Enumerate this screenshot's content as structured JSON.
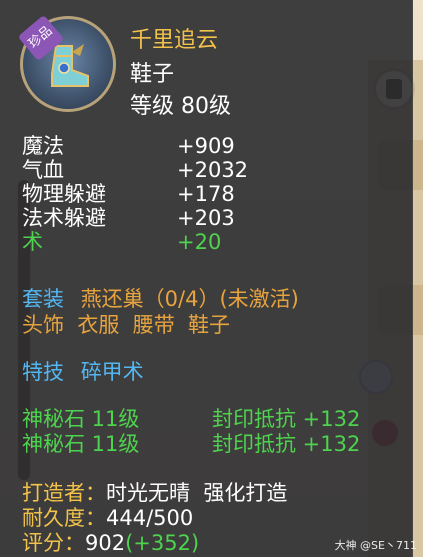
{
  "item": {
    "rarity_tag": "珍品",
    "name": "千里追云",
    "type": "鞋子",
    "level": "等级 80级"
  },
  "stats": [
    {
      "label": "魔法",
      "value": "+909"
    },
    {
      "label": "气血",
      "value": "+2032"
    },
    {
      "label": "物理躲避",
      "value": "+178"
    },
    {
      "label": "法术躲避",
      "value": "+203"
    },
    {
      "label": "术",
      "value": "+20"
    }
  ],
  "set": {
    "label": "套装",
    "name": "燕还巢（0/4）(未激活)",
    "pieces": "头饰  衣服  腰带  鞋子"
  },
  "skill": {
    "label": "特技",
    "name": "碎甲术"
  },
  "stones": [
    {
      "name": "神秘石 11级",
      "effect": "封印抵抗 +132"
    },
    {
      "name": "神秘石 11级",
      "effect": "封印抵抗 +132"
    }
  ],
  "meta": {
    "maker_label": "打造者：",
    "maker_value": "时光无晴  强化打造",
    "durability_label": "耐久度：",
    "durability_value": "444/500",
    "score_label": "评分：",
    "score_value": "902",
    "score_bonus": "(+352)"
  },
  "watermark": "大神 @SE丶711",
  "colors": {
    "title": "#f2c24a",
    "green": "#4ed34e",
    "blue": "#52b7f2",
    "orange": "#e7a43e"
  }
}
